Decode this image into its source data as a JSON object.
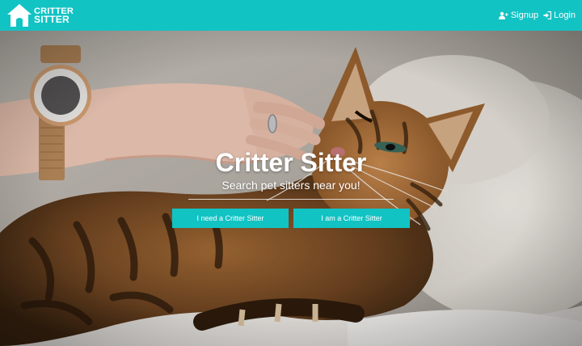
{
  "brand": {
    "line1": "CRITTER",
    "line2": "SITTER",
    "logo_icon": "house-icon"
  },
  "nav": {
    "signup_label": "Signup",
    "signup_icon": "user-plus-icon",
    "login_label": "Login",
    "login_icon": "sign-in-icon"
  },
  "hero": {
    "title": "Critter Sitter",
    "subtitle": "Search pet sitters near you!",
    "need_sitter_label": "I need a Critter Sitter",
    "am_sitter_label": "I am a Critter Sitter"
  },
  "colors": {
    "brand": "#12c3c4",
    "text_light": "#ffffff"
  }
}
